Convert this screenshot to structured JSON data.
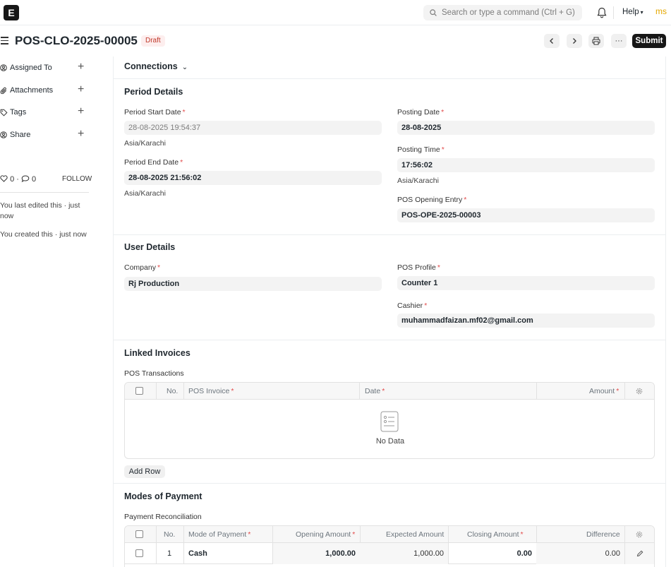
{
  "navbar": {
    "logo_letter": "E",
    "search_placeholder": "Search or type a command (Ctrl + G)",
    "help_label": "Help",
    "avatar_initials": "ms"
  },
  "header": {
    "title": "POS-CLO-2025-00005",
    "status": "Draft",
    "submit_label": "Submit",
    "more_label": "···"
  },
  "sidebar": {
    "items": [
      {
        "label": "Assigned To"
      },
      {
        "label": "Attachments"
      },
      {
        "label": "Tags"
      },
      {
        "label": "Share"
      }
    ],
    "likes": "0",
    "comments": "0",
    "follow_label": "FOLLOW",
    "last_edited": "You last edited this · just now",
    "created": "You created this · just now"
  },
  "connections": {
    "label": "Connections"
  },
  "period_details": {
    "title": "Period Details",
    "start_label": "Period Start Date",
    "start_value": "28-08-2025 19:54:37",
    "start_tz": "Asia/Karachi",
    "end_label": "Period End Date",
    "end_value": "28-08-2025 21:56:02",
    "end_tz": "Asia/Karachi",
    "posting_date_label": "Posting Date",
    "posting_date_value": "28-08-2025",
    "posting_time_label": "Posting Time",
    "posting_time_value": "17:56:02",
    "posting_time_tz": "Asia/Karachi",
    "opening_entry_label": "POS Opening Entry",
    "opening_entry_value": "POS-OPE-2025-00003"
  },
  "user_details": {
    "title": "User Details",
    "company_label": "Company",
    "company_value": "Rj Production",
    "profile_label": "POS Profile",
    "profile_value": "Counter 1",
    "cashier_label": "Cashier",
    "cashier_value": "muhammadfaizan.mf02@gmail.com"
  },
  "linked_invoices": {
    "title": "Linked Invoices",
    "table_label": "POS Transactions",
    "columns": {
      "no": "No.",
      "invoice": "POS Invoice",
      "date": "Date",
      "amount": "Amount"
    },
    "empty_text": "No Data",
    "add_row_label": "Add Row"
  },
  "modes_of_payment": {
    "title": "Modes of Payment",
    "table_label": "Payment Reconciliation",
    "columns": {
      "no": "No.",
      "mode": "Mode of Payment",
      "opening": "Opening Amount",
      "expected": "Expected Amount",
      "closing": "Closing Amount",
      "difference": "Difference"
    },
    "rows": [
      {
        "no": "1",
        "mode": "Cash",
        "opening": "1,000.00",
        "expected": "1,000.00",
        "closing": "0.00",
        "difference": "0.00"
      }
    ]
  }
}
